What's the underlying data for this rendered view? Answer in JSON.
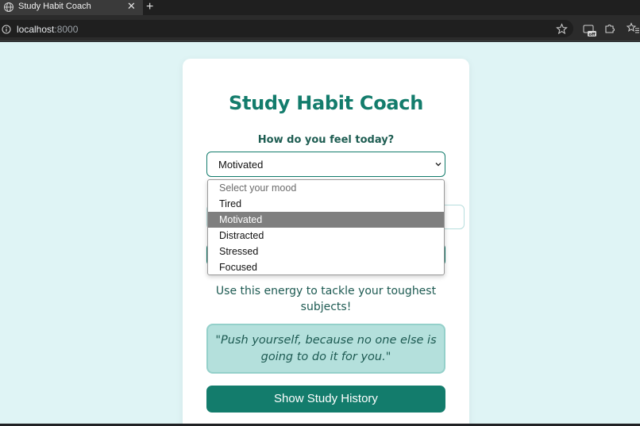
{
  "browser": {
    "tab_title": "Study Habit Coach",
    "tab_close": "✕",
    "new_tab": "+",
    "url_host": "localhost",
    "url_rest": ":8000"
  },
  "app": {
    "title": "Study Habit Coach",
    "mood_question": "How do you feel today?",
    "selected_mood": "Motivated",
    "mood_options": [
      {
        "label": "Select your mood",
        "placeholder": true
      },
      {
        "label": "Tired"
      },
      {
        "label": "Motivated",
        "selected": true
      },
      {
        "label": "Distracted"
      },
      {
        "label": "Stressed"
      },
      {
        "label": "Focused"
      }
    ],
    "message": "Use this energy to tackle your toughest subjects!",
    "quote": "\"Push yourself, because no one else is going to do it for you.\"",
    "history_button": "Show Study History"
  },
  "colors": {
    "accent": "#137c6c",
    "background": "#dff4f5",
    "quote_bg": "#b4e0dc",
    "dropdown_highlight": "#7f7f7f"
  }
}
